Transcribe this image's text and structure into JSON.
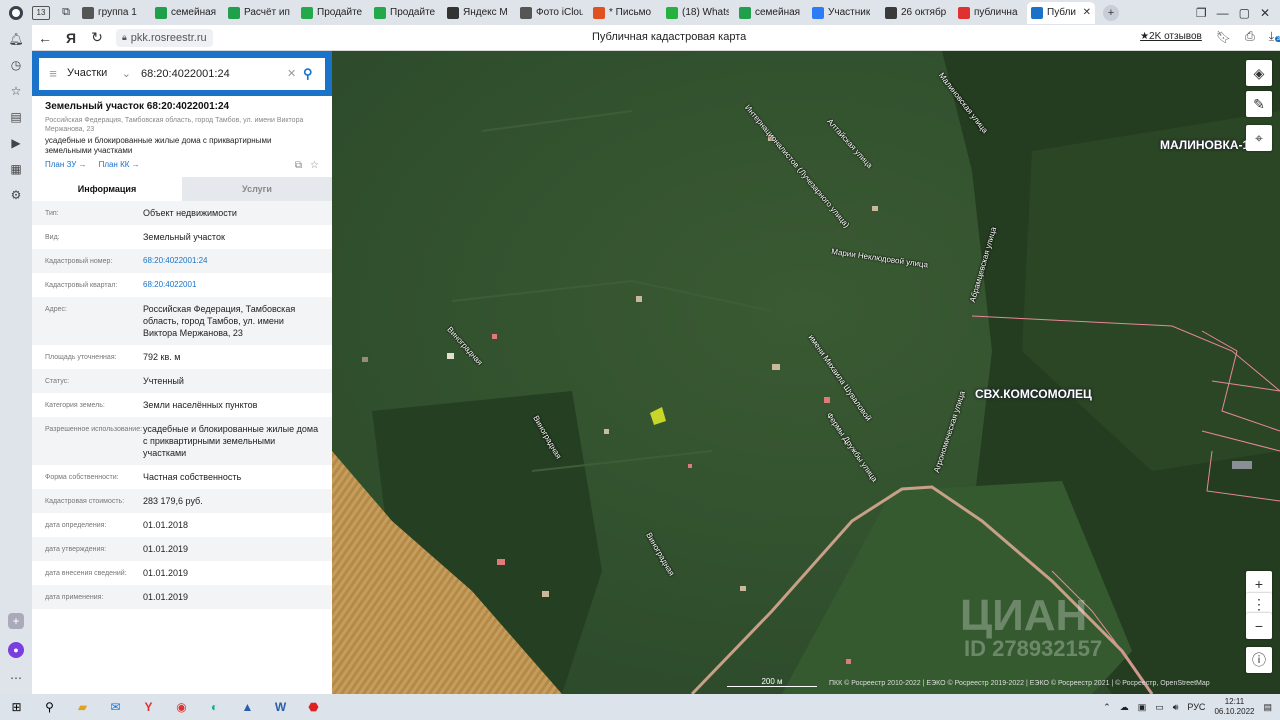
{
  "browser": {
    "tabs": [
      {
        "title": "группа 1",
        "icon": "group-icon",
        "color": "#555555"
      },
      {
        "title": "семейная",
        "icon": "cian-icon",
        "color": "#20a04a"
      },
      {
        "title": "Расчёт ип",
        "icon": "cian-icon",
        "color": "#20a04a"
      },
      {
        "title": "Продайте",
        "icon": "domclick-icon",
        "color": "#24a84a"
      },
      {
        "title": "Продайте",
        "icon": "domclick-icon",
        "color": "#24a84a"
      },
      {
        "title": "Яндекс М",
        "icon": "yandex-music-icon",
        "color": "#333333"
      },
      {
        "title": "Фото iClou",
        "icon": "apple-icon",
        "color": "#555555"
      },
      {
        "title": "* Письмо",
        "icon": "mail-icon",
        "color": "#e05020"
      },
      {
        "title": "(18) Whats",
        "icon": "whatsapp-icon",
        "color": "#25b040"
      },
      {
        "title": "семейная",
        "icon": "cian-icon",
        "color": "#20a04a"
      },
      {
        "title": "Участник",
        "icon": "zoom-icon",
        "color": "#2d7cf6"
      },
      {
        "title": "26 октябр",
        "icon": "calendar-icon",
        "color": "#3a3a3a"
      },
      {
        "title": "публична",
        "icon": "yandex-icon",
        "color": "#e03030"
      },
      {
        "title": "Публи",
        "icon": "rosreestr-icon",
        "color": "#1a73c9",
        "active": true
      }
    ],
    "url": "pkk.rosreestr.ru",
    "page_title": "Публичная кадастровая карта",
    "reviews": "★2K отзывов",
    "downloads_badge": "37"
  },
  "search": {
    "type_label": "Участки",
    "query": "68:20:4022001:24"
  },
  "object": {
    "title": "Земельный участок 68:20:4022001:24",
    "address": "Российская Федерация, Тамбовская область, город Тамбов, ул. имени Виктора Мержанова, 23",
    "use": "усадебные и блокированные жилые дома с приквартирными земельными участками",
    "plan_zu": "План ЗУ →",
    "plan_kk": "План КК →",
    "tab_info": "Информация",
    "tab_services": "Услуги",
    "rows": [
      {
        "label": "Тип:",
        "value": "Объект недвижимости",
        "link": false
      },
      {
        "label": "Вид:",
        "value": "Земельный участок",
        "link": false
      },
      {
        "label": "Кадастровый номер:",
        "value": "68:20:4022001:24",
        "link": true
      },
      {
        "label": "Кадастровый квартал:",
        "value": "68:20:4022001",
        "link": true
      },
      {
        "label": "Адрес:",
        "value": "Российская Федерация, Тамбовская область, город Тамбов, ул. имени Виктора Мержанова, 23",
        "link": false
      },
      {
        "label": "Площадь уточненная:",
        "value": "792 кв. м",
        "link": false
      },
      {
        "label": "Статус:",
        "value": "Учтенный",
        "link": false
      },
      {
        "label": "Категория земель:",
        "value": "Земли населённых пунктов",
        "link": false
      },
      {
        "label": "Разрешенное использование:",
        "value": "усадебные и блокированные жилые дома с приквартирными земельными участками",
        "link": false
      },
      {
        "label": "Форма собственности:",
        "value": "Частная собственность",
        "link": false
      },
      {
        "label": "Кадастровая стоимость:",
        "value": "283 179,6 руб.",
        "link": false
      },
      {
        "label": "дата определения:",
        "value": "01.01.2018",
        "link": false
      },
      {
        "label": "дата утверждения:",
        "value": "01.01.2019",
        "link": false
      },
      {
        "label": "дата внесения сведений:",
        "value": "01.01.2019",
        "link": false
      },
      {
        "label": "дата применения:",
        "value": "01.01.2019",
        "link": false
      }
    ]
  },
  "map": {
    "street_labels": [
      "Малиновская улица",
      "Интернационалистов (Лучезарного улица)",
      "Алтайская улица",
      "Марии Неклюдовой улица",
      "Абрамцевская улица",
      "Виноградная",
      "имени Михаила Шуваловой",
      "Фермы Дружбы улица",
      "Виноградная",
      "Агрономическая улица",
      "Виноградная"
    ],
    "place_labels": [
      "МАЛИНОВКА-1",
      "СВХ.КОМСОМОЛЕЦ"
    ],
    "watermark_main": "ЦИАН",
    "watermark_id": "ID 278932157",
    "scale": "200 м",
    "copyright": "ПКК © Росреестр 2010-2022 | ЕЭКО © Росреестр 2019-2022 | ЕЭКО © Росреестр 2021 | © Росреестр, OpenStreetMap",
    "parcel_color": "#c8d629",
    "boundary_color": "#e8889a"
  },
  "taskbar": {
    "lang": "РУС",
    "time": "12:11",
    "date": "06.10.2022"
  }
}
